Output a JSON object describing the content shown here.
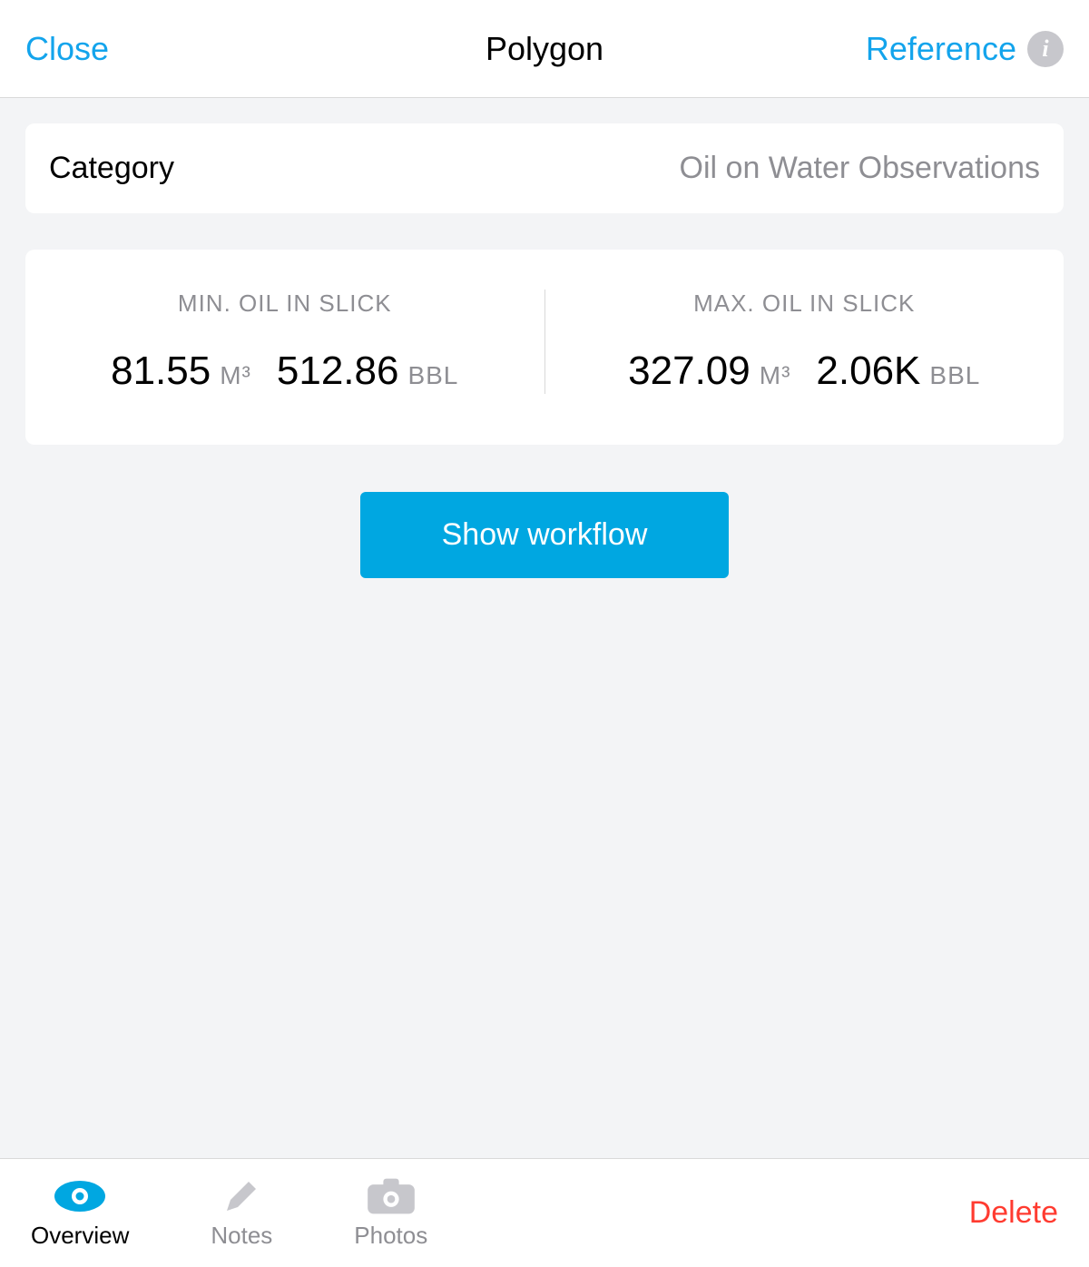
{
  "header": {
    "close": "Close",
    "title": "Polygon",
    "reference": "Reference"
  },
  "category": {
    "label": "Category",
    "value": "Oil on Water Observations"
  },
  "stats": {
    "min": {
      "title": "MIN. OIL IN SLICK",
      "m3_value": "81.55",
      "m3_unit": "M³",
      "bbl_value": "512.86",
      "bbl_unit": "BBL"
    },
    "max": {
      "title": "MAX. OIL IN SLICK",
      "m3_value": "327.09",
      "m3_unit": "M³",
      "bbl_value": "2.06K",
      "bbl_unit": "BBL"
    }
  },
  "workflow_button": "Show workflow",
  "tabs": {
    "overview": "Overview",
    "notes": "Notes",
    "photos": "Photos"
  },
  "delete": "Delete"
}
